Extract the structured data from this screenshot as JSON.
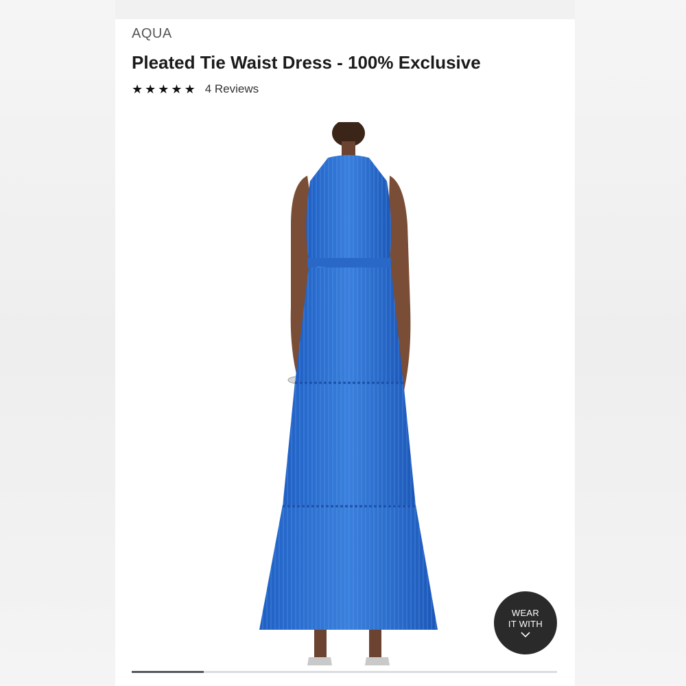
{
  "product": {
    "brand": "AQUA",
    "title": "Pleated Tie Waist Dress - 100% Exclusive",
    "rating": {
      "stars": 5,
      "star_glyph": "★",
      "reviews_label": "4 Reviews"
    },
    "image": {
      "alt": "Model wearing a blue pleated tiered halter maxi dress with tie waist",
      "dress_color": "#2f6fd0"
    }
  },
  "wear_it_with": {
    "line1": "WEAR",
    "line2": "IT WITH",
    "icon": "chevron-down-icon"
  },
  "gallery": {
    "progress": 0.17
  },
  "colors": {
    "card_bg": "#ffffff",
    "page_bg": "#f1f1f1",
    "button_bg": "#2a2a2a"
  }
}
